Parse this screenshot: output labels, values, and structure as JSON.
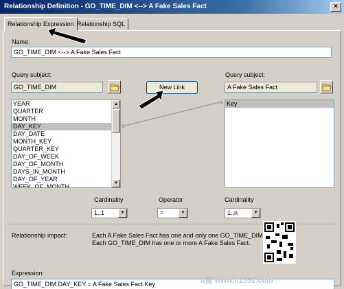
{
  "window": {
    "title": "Relationship Definition - GO_TIME_DIM <--> A Fake Sales Fact",
    "close_glyph": "×"
  },
  "tabs": [
    {
      "label": "Relationship Expression",
      "active": true
    },
    {
      "label": "Relationship SQL",
      "active": false
    }
  ],
  "name": {
    "label": "Name:",
    "value": "GO_TIME_DIM <--> A Fake Sales Fact"
  },
  "left_query": {
    "label": "Query subject:",
    "value": "GO_TIME_DIM",
    "items": [
      "YEAR",
      "QUARTER",
      "MONTH",
      "DAY_KEY",
      "DAY_DATE",
      "MONTH_KEY",
      "QUARTER_KEY",
      "DAY_OF_WEEK",
      "DAY_OF_MONTH",
      "DAYS_IN_MONTH",
      "DAY_OF_YEAR",
      "WEEK_OF_MONTH"
    ],
    "selected_index": 3
  },
  "right_query": {
    "label": "Query subject:",
    "value": "A Fake Sales Fact",
    "items": [
      "Key"
    ],
    "selected_index": 0
  },
  "new_link_button": "New Link",
  "cardinality_left": {
    "label": "Cardinality",
    "value": "1..1"
  },
  "operator": {
    "label": "Operator",
    "value": "="
  },
  "cardinality_right": {
    "label": "Cardinality",
    "value": "1..n"
  },
  "impact": {
    "label": "Relationship impact:",
    "line1": "Each A Fake Sales Fact has one and only one GO_TIME_DIM.",
    "line2": "Each GO_TIME_DIM has one or more A Fake Sales Fact."
  },
  "expression": {
    "label": "Expression:",
    "value": "GO_TIME_DIM.DAY_KEY = A Fake Sales Fact.Key"
  },
  "watermark": "it屋 www.it1352.com",
  "colors": {
    "title_gradient_start": "#0a246a",
    "dialog_bg": "#d4d0c8",
    "selection": "#c0c0c0",
    "link_line": "#a0a0a0"
  },
  "icons": [
    "folder-icon",
    "arrow-pointer-icon",
    "qr-code-icon",
    "dropdown-arrow-icon"
  ]
}
